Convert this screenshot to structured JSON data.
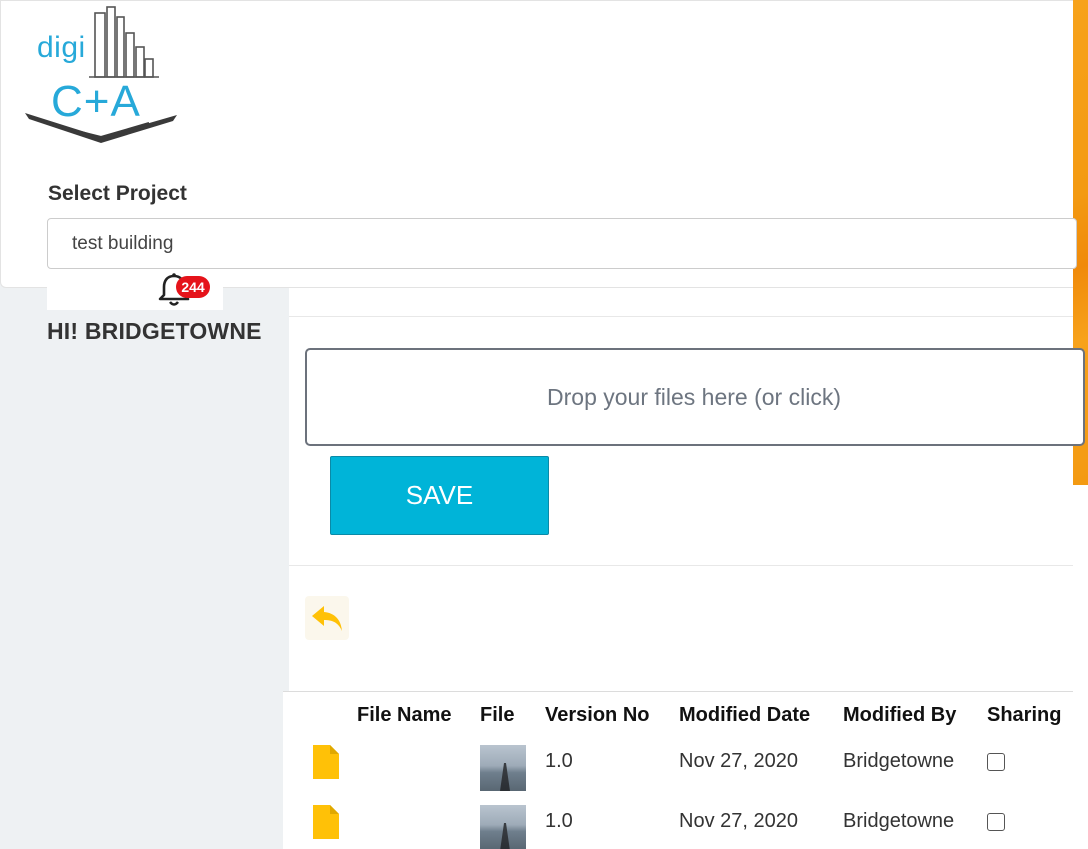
{
  "brand": {
    "logo_digi": "digi",
    "logo_ca": "C+A"
  },
  "header": {
    "select_label": "Select Project",
    "selected_project": "test building"
  },
  "notifications": {
    "count": "244"
  },
  "user": {
    "greeting": "HI! BRIDGETOWNE"
  },
  "upload": {
    "dropzone_text": "Drop your files here (or click)",
    "save_label": "SAVE"
  },
  "table": {
    "columns": [
      "File Name",
      "File",
      "Version No",
      "Modified Date",
      "Modified By",
      "Sharing"
    ],
    "rows": [
      {
        "file_name": "",
        "version": "1.0",
        "modified_date": "Nov 27, 2020",
        "modified_by": "Bridgetowne",
        "shared": false
      },
      {
        "file_name": "",
        "version": "1.0",
        "modified_date": "Nov 27, 2020",
        "modified_by": "Bridgetowne",
        "shared": false
      }
    ]
  },
  "colors": {
    "accent_cyan": "#00b4d8",
    "badge_red": "#e5131a",
    "file_icon_yellow": "#ffc107",
    "scrollbar_orange": "#f39a12"
  },
  "icons": [
    "bell-icon",
    "power-icon",
    "back-arrow-icon",
    "file-icon"
  ]
}
